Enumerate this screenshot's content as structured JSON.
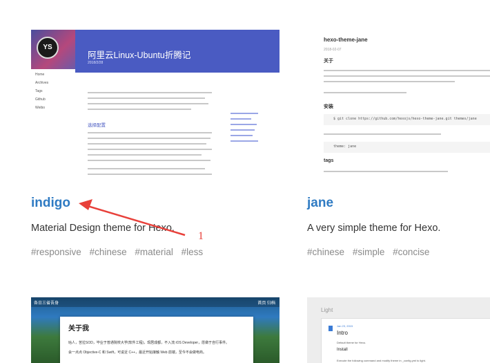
{
  "cards": [
    {
      "name": "indigo",
      "description": "Material Design theme for Hexo.",
      "tags": [
        "#responsive",
        "#chinese",
        "#material",
        "#less"
      ],
      "thumb": {
        "title": "阿里云Linux-Ubuntu折腾记",
        "date": "2018/2/28",
        "avatar": "YS",
        "nav": [
          "Home",
          "Archives",
          "Tags",
          "Github",
          "Weibo"
        ],
        "section": "选择配置"
      }
    },
    {
      "name": "jane",
      "description": "A very simple theme for Hexo.",
      "tags": [
        "#chinese",
        "#simple",
        "#concise"
      ],
      "thumb": {
        "title": "hexo-theme-jane",
        "date": "2018-02-07",
        "about": "关于",
        "install": "安装",
        "install_code": "$ git clone https://github.com/hexojs/hexo-theme-jane.git themes/jane",
        "config_code": "theme: jane",
        "tags_heading": "tags"
      }
    },
    {
      "thumb": {
        "site_title": "各日三省吾身",
        "nav": "首页  归档",
        "title": "关于我",
        "line1": "咕人，苦拉SOD，毕业于普通院校大学(软件工程)，现居成都，不入流 iOS Developer，愿做于自行事件。",
        "line2": "会一点点 Objective-C 和 Swift，可说近 C++，最近开始接触 Web 前端，至今不会做电商。"
      }
    },
    {
      "thumb": {
        "label": "Light",
        "date": "Jan 23, 2015",
        "title": "Intro",
        "line1": "Default theme for Hexo.",
        "install": "Install",
        "line2": "Execute the following command and modify theme in _config.yml to light."
      }
    }
  ],
  "annotation": {
    "label": "1",
    "color": "#e8403a"
  }
}
